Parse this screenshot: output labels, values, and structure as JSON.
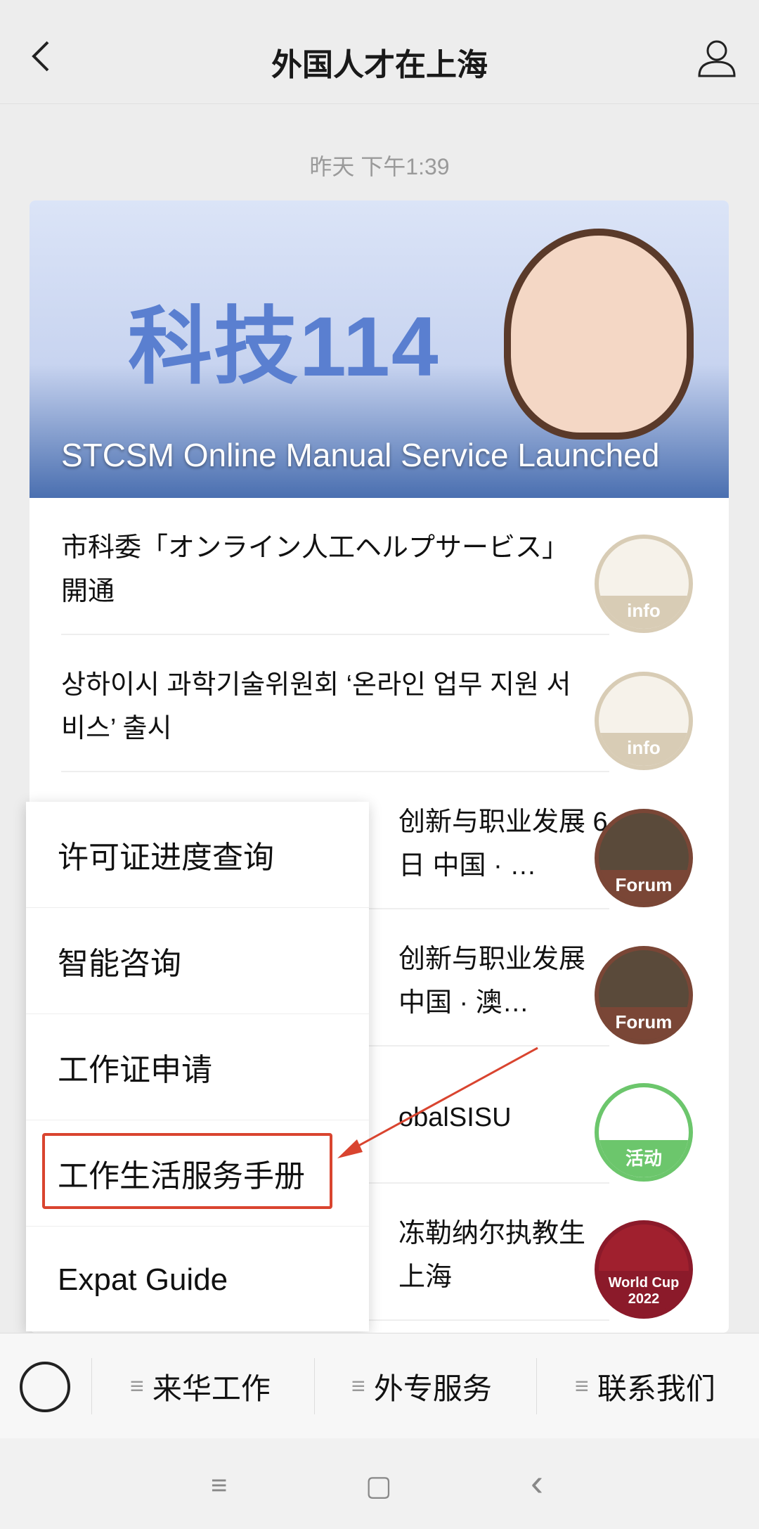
{
  "header": {
    "title": "外国人才在上海"
  },
  "timestamp": "昨天 下午1:39",
  "banner": {
    "logo_text": "科技114",
    "title": "STCSM Online Manual Service Launched"
  },
  "articles": [
    {
      "title": "市科委「オンライン人工ヘルプサービス」開通",
      "thumb": "info",
      "color": "#d8ccb5"
    },
    {
      "title": "상하이시 과학기술위원회 ‘온라인 업무 지원 서비스’ 출시",
      "thumb": "info",
      "color": "#d8ccb5"
    },
    {
      "title": "创新与职业发展 6日 中国 · …",
      "thumb": "Forum",
      "color": "#7a4636"
    },
    {
      "title": "创新与职业发展 中国 · 澳…",
      "thumb": "Forum",
      "color": "#7a4636"
    },
    {
      "title": "obalSISU",
      "thumb": "活动",
      "color": "#6cc66c"
    },
    {
      "title": "冻勒纳尔执教生 上海",
      "thumb": "World Cup 2022",
      "color": "#8b1a2a"
    }
  ],
  "menu": {
    "items": [
      "许可证进度查询",
      "智能咨询",
      "工作证申请",
      "工作生活服务手册",
      "Expat Guide"
    ],
    "highlight_color": "#d9442f"
  },
  "bottom_tabs": [
    "来华工作",
    "外专服务",
    "联系我们"
  ],
  "nav": {
    "menu": "≡",
    "home": "▢",
    "back": "‹"
  }
}
